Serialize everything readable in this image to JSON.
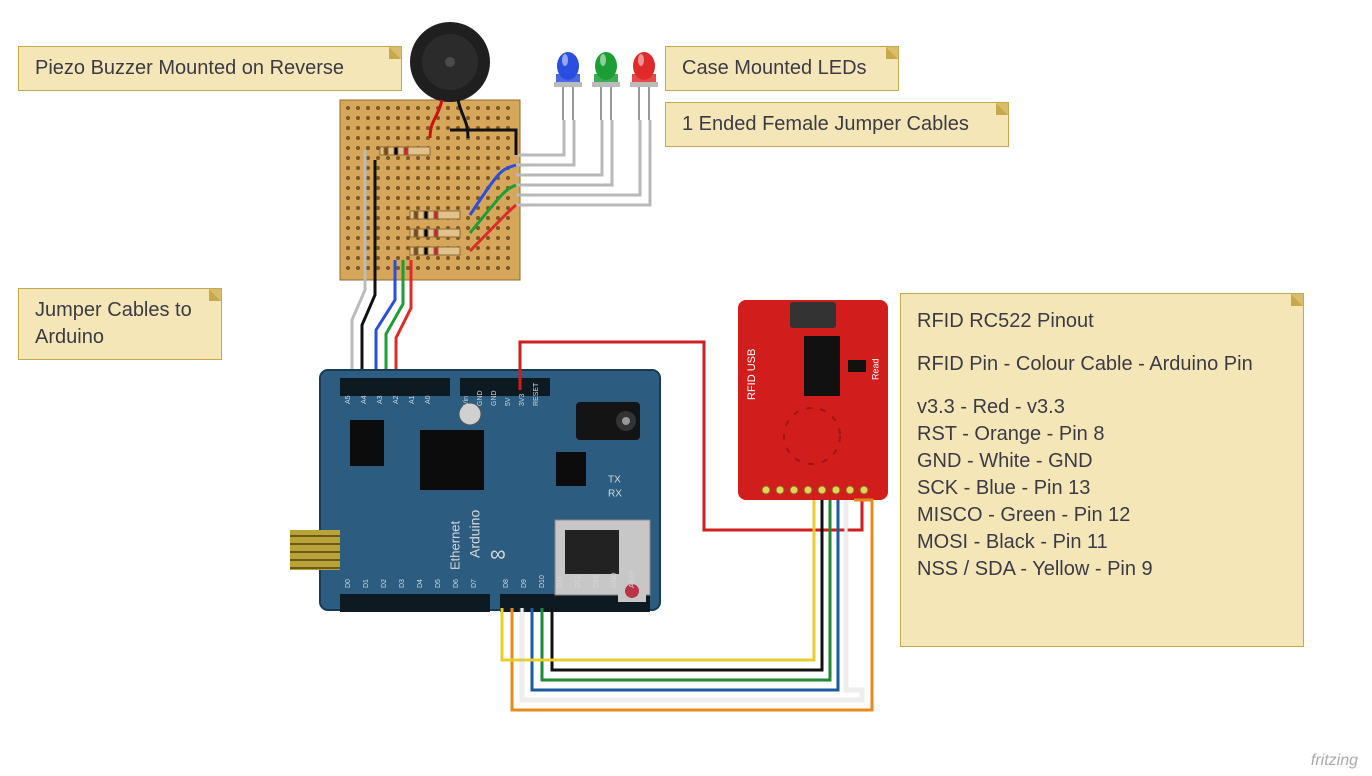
{
  "notes": {
    "buzzer": "Piezo Buzzer Mounted on Reverse",
    "leds": "Case Mounted LEDs",
    "jumpers_led": "1 Ended Female Jumper  Cables",
    "jumpers_arduino": "Jumper Cables to Arduino"
  },
  "rfid_note": {
    "title": "RFID RC522 Pinout",
    "subtitle": "RFID Pin - Colour Cable - Arduino Pin",
    "rows": [
      "v3.3 - Red - v3.3",
      "RST - Orange - Pin 8",
      "GND - White - GND",
      "SCK - Blue - Pin 13",
      "MISCO - Green - Pin 12",
      "MOSI - Black - Pin 11",
      "NSS / SDA - Yellow - Pin 9"
    ]
  },
  "credit": "fritzing",
  "arduino": {
    "brand": "Arduino",
    "ethernet": "Ethernet",
    "infinity": "∞",
    "tx": "TX",
    "rx": "RX",
    "analog": [
      "A5",
      "A4",
      "A3",
      "A2",
      "A1",
      "A0"
    ],
    "power": [
      "Vin",
      "GND",
      "GND",
      "5V",
      "3V3",
      "RESET"
    ],
    "digital": [
      "D0",
      "D1",
      "D2",
      "D3",
      "D4",
      "D5",
      "D6",
      "D7",
      "D8",
      "D9",
      "D10",
      "D11",
      "D12",
      "D13",
      "GND",
      "AREF"
    ]
  },
  "rfid": {
    "title": "RFID USB",
    "read": "Read"
  },
  "wires": {
    "rfid": [
      {
        "color": "#D11D1D",
        "name": "v3.3"
      },
      {
        "color": "#E68A1C",
        "name": "RST"
      },
      {
        "color": "#FFFFFF",
        "name": "GND"
      },
      {
        "color": "#1E5B9E",
        "name": "SCK"
      },
      {
        "color": "#1F8A35",
        "name": "MISO"
      },
      {
        "color": "#111111",
        "name": "MOSI"
      },
      {
        "color": "#E8CE2B",
        "name": "NSS"
      }
    ]
  },
  "leds": [
    {
      "color": "#2A4EE0",
      "name": "blue"
    },
    {
      "color": "#1C9E36",
      "name": "green"
    },
    {
      "color": "#E02A2A",
      "name": "red"
    }
  ]
}
